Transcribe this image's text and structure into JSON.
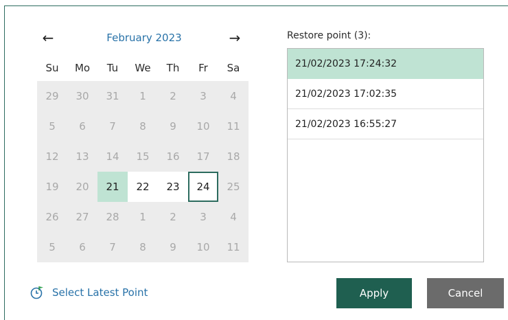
{
  "calendar": {
    "prev_icon": "←",
    "next_icon": "→",
    "month_title": "February 2023",
    "weekdays": [
      "Su",
      "Mo",
      "Tu",
      "We",
      "Th",
      "Fr",
      "Sa"
    ],
    "weeks": [
      [
        "29",
        "30",
        "31",
        "1",
        "2",
        "3",
        "4"
      ],
      [
        "5",
        "6",
        "7",
        "8",
        "9",
        "10",
        "11"
      ],
      [
        "12",
        "13",
        "14",
        "15",
        "16",
        "17",
        "18"
      ],
      [
        "19",
        "20",
        "21",
        "22",
        "23",
        "24",
        "25"
      ],
      [
        "26",
        "27",
        "28",
        "1",
        "2",
        "3",
        "4"
      ],
      [
        "5",
        "6",
        "7",
        "8",
        "9",
        "10",
        "11"
      ]
    ],
    "selected_day": "21",
    "today_day": "24",
    "available_days": [
      "21",
      "22",
      "23",
      "24"
    ]
  },
  "restore": {
    "label": "Restore point (3):",
    "points": [
      "21/02/2023 17:24:32",
      "21/02/2023 17:02:35",
      "21/02/2023 16:55:27"
    ],
    "selected_index": 0
  },
  "footer": {
    "latest_label": "Select Latest Point",
    "apply_label": "Apply",
    "cancel_label": "Cancel"
  },
  "colors": {
    "accent": "#1f5f50",
    "selection": "#bfe3d3",
    "link": "#2872a8"
  }
}
